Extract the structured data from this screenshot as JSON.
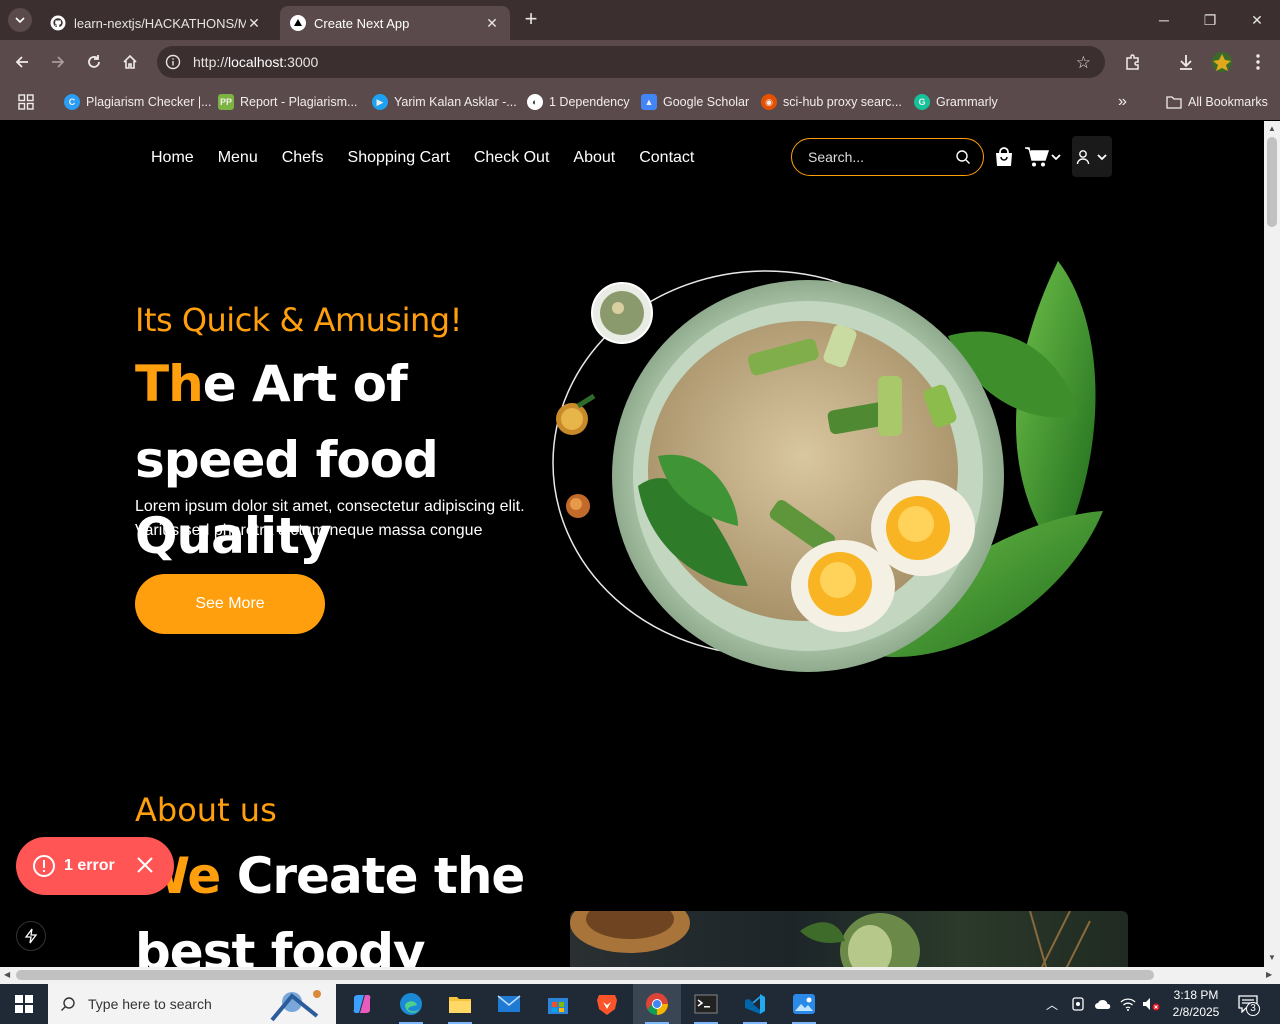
{
  "browser": {
    "tabs": [
      {
        "title": "learn-nextjs/HACKATHONS/Ma",
        "active": false
      },
      {
        "title": "Create Next App",
        "active": true
      }
    ],
    "url_scheme": "http://",
    "url_host": "localhost",
    "url_port": ":3000",
    "bookmarks": [
      {
        "label": "Plagiarism Checker |...",
        "icon": "plagiarism-checker-icon",
        "color": "#2a9df4"
      },
      {
        "label": "Report - Plagiarism...",
        "icon": "pp-icon",
        "color": "#7cb342"
      },
      {
        "label": "Yarim Kalan Asklar -...",
        "icon": "play-icon",
        "color": "#1da1f2"
      },
      {
        "label": "1 Dependency",
        "icon": "globe-icon",
        "color": "#ffffff"
      },
      {
        "label": "Google Scholar",
        "icon": "scholar-icon",
        "color": "#4285f4"
      },
      {
        "label": "sci-hub proxy searc...",
        "icon": "scihub-icon",
        "color": "#e65100"
      },
      {
        "label": "Grammarly",
        "icon": "grammarly-icon",
        "color": "#15c39a"
      }
    ],
    "all_bookmarks_label": "All Bookmarks"
  },
  "site": {
    "nav": [
      "Home",
      "Menu",
      "Chefs",
      "Shopping Cart",
      "Check Out",
      "About",
      "Contact"
    ],
    "search_placeholder": "Search...",
    "accent": "#ff9f0d"
  },
  "hero": {
    "kicker": "Its Quick & Amusing!",
    "title_highlight": "Th",
    "title_rest": "e Art of speed food Quality",
    "description": "Lorem ipsum dolor sit amet, consectetur adipiscing elit. Varius sed pharetra dictum neque massa congue",
    "cta": "See More"
  },
  "about": {
    "kicker": "About us",
    "title_highlight": "We",
    "title_rest": " Create the best foody"
  },
  "error_overlay": {
    "label": "1 error",
    "color": "#ff5555"
  },
  "taskbar": {
    "search_placeholder": "Type here to search",
    "time": "3:18 PM",
    "date": "2/8/2025",
    "notification_count": "3"
  }
}
